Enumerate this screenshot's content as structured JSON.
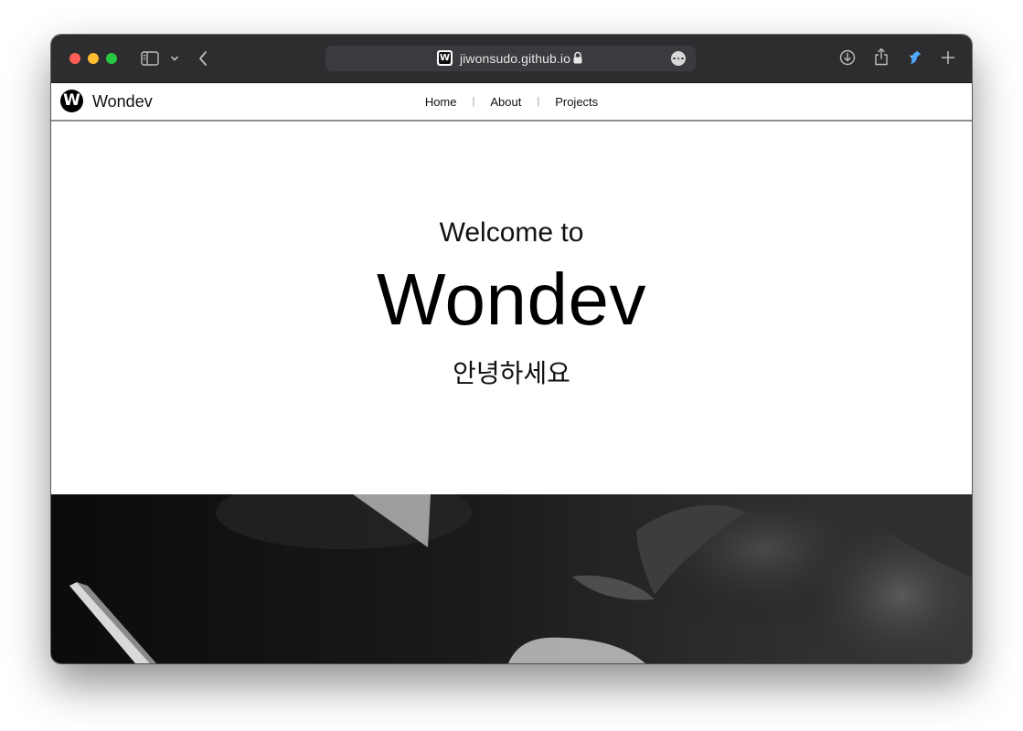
{
  "browser": {
    "url": "jiwonsudo.github.io",
    "icons": [
      "sidebar-icon",
      "chevron-down-icon",
      "back-arrow-icon",
      "lock-icon",
      "more-icon",
      "download-icon",
      "share-icon",
      "extension-icon",
      "plus-icon"
    ]
  },
  "site": {
    "logo_letter": "W",
    "brand": "Wondev",
    "nav": [
      {
        "label": "Home"
      },
      {
        "label": "About"
      },
      {
        "label": "Projects"
      }
    ],
    "separator": "|"
  },
  "hero": {
    "welcome": "Welcome to",
    "title": "Wondev",
    "greeting": "안녕하세요"
  },
  "colors": {
    "toolbar_bg": "#2d2d30",
    "nav_border": "#8e8e8e",
    "banner_tone": "#111111"
  }
}
